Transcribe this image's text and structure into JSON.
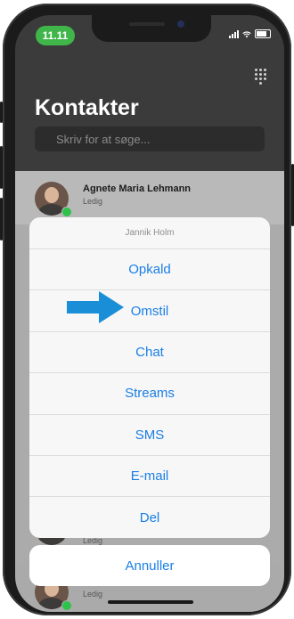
{
  "status_bar": {
    "time": "11.11"
  },
  "header": {
    "title": "Kontakter",
    "search_placeholder": "Skriv for at søge..."
  },
  "contacts": [
    {
      "name": "Agnete Maria Lehmann",
      "status": "Ledig"
    },
    {
      "name": "",
      "status": "Ledig"
    },
    {
      "name": "",
      "status": "Ledig"
    }
  ],
  "action_sheet": {
    "title": "Jannik Holm",
    "items": [
      "Opkald",
      "Omstil",
      "Chat",
      "Streams",
      "SMS",
      "E-mail",
      "Del"
    ],
    "cancel": "Annuller"
  },
  "colors": {
    "accent": "#1a7fe6",
    "presence": "#2fc24a",
    "time_pill": "#3fb54a",
    "arrow": "#1a8fd8"
  },
  "icons": [
    "keypad-icon",
    "signal-icon",
    "wifi-icon",
    "battery-icon",
    "pointer-arrow-icon"
  ]
}
